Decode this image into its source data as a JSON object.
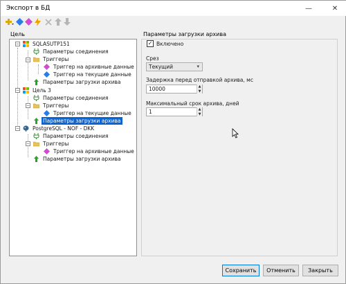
{
  "window": {
    "title": "Экспорт в БД",
    "minimize": "—",
    "close": "✕"
  },
  "toolbar": {
    "items": [
      {
        "icon": "add-dropdown-icon",
        "color": "#e0a800"
      },
      {
        "icon": "diamond-blue-icon",
        "color": "#2a7de1"
      },
      {
        "icon": "diamond-pink-icon",
        "color": "#d44ad4"
      },
      {
        "icon": "lightning-icon",
        "color": "#f0a000"
      },
      {
        "icon": "delete-icon",
        "color": "#b5b5b5"
      },
      {
        "icon": "move-up-icon",
        "color": "#b5b5b5"
      },
      {
        "icon": "move-down-icon",
        "color": "#b5b5b5"
      }
    ]
  },
  "left_group_label": "Цель",
  "tree": {
    "nodes": [
      {
        "label": "SQLASUTP151",
        "icon": "windows-db-icon"
      },
      {
        "label": "Параметры соединения",
        "icon": "plug-icon"
      },
      {
        "label": "Триггеры",
        "icon": "folder-icon"
      },
      {
        "label": "Триггер на архивные данные",
        "icon": "diamond-pink-icon"
      },
      {
        "label": "Триггер на текущие данные",
        "icon": "diamond-blue-icon"
      },
      {
        "label": "Параметры загрузки архива",
        "icon": "green-arrow-icon"
      },
      {
        "label": "Цель 3",
        "icon": "windows-db-icon"
      },
      {
        "label": "Параметры соединения",
        "icon": "plug-icon"
      },
      {
        "label": "Триггеры",
        "icon": "folder-icon"
      },
      {
        "label": "Триггер на текущие данные",
        "icon": "diamond-blue-icon"
      },
      {
        "label": "Параметры загрузки архива",
        "icon": "green-arrow-icon",
        "selected": true
      },
      {
        "label": "PostgreSQL - NOF - DKK",
        "icon": "postgres-icon"
      },
      {
        "label": "Параметры соединения",
        "icon": "plug-icon"
      },
      {
        "label": "Триггеры",
        "icon": "folder-icon"
      },
      {
        "label": "Триггер на архивные данные",
        "icon": "diamond-pink-icon"
      },
      {
        "label": "Параметры загрузки архива",
        "icon": "green-arrow-icon"
      }
    ]
  },
  "right_panel": {
    "group_label": "Параметры загрузки архива",
    "enabled_checkbox": {
      "label": "Включено",
      "checked": true,
      "mark": "✓"
    },
    "slice": {
      "label": "Срез",
      "value": "Текущий"
    },
    "delay": {
      "label": "Задержка перед отправкой архива, мс",
      "value": "10000"
    },
    "max_age": {
      "label": "Максимальный срок архива, дней",
      "value": "1"
    }
  },
  "buttons": {
    "save": "Сохранить",
    "cancel": "Отменить",
    "close": "Закрыть"
  },
  "colors": {
    "selection": "#0a64d3",
    "window_bg": "#f0f0f0"
  }
}
